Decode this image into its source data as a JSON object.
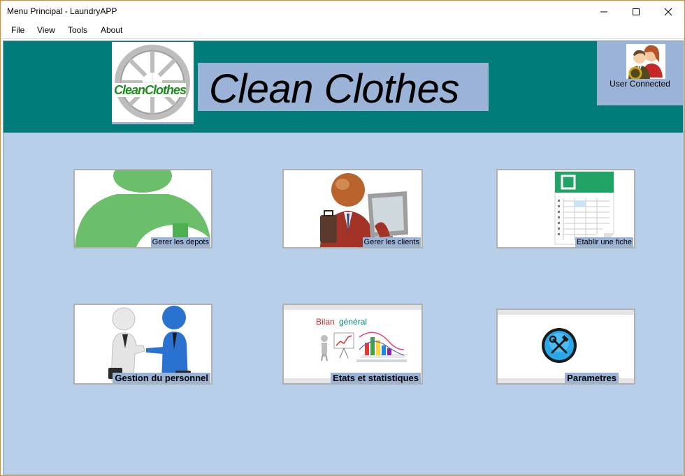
{
  "window": {
    "title": "Menu Principal - LaundryAPP"
  },
  "menu": {
    "items": [
      "File",
      "View",
      "Tools",
      "About"
    ]
  },
  "header": {
    "logo_text": "CleanClothes",
    "app_title": "Clean Clothes",
    "user_label": "User Connected"
  },
  "tiles": {
    "depots": "Gerer les depots",
    "clients": "Gerer les clients",
    "fiche": "Etablir une fiche",
    "personnel": "Gestion du personnel",
    "stats": "Etats et statistiques",
    "stats_banner_word1": "Bilan",
    "stats_banner_word2": "général",
    "parametres": "Parametres"
  },
  "colors": {
    "header_teal": "#007c7a",
    "client_bg": "#b8cfe9",
    "panel_blue": "#9ab3d6",
    "logo_green": "#1f8a1f"
  }
}
